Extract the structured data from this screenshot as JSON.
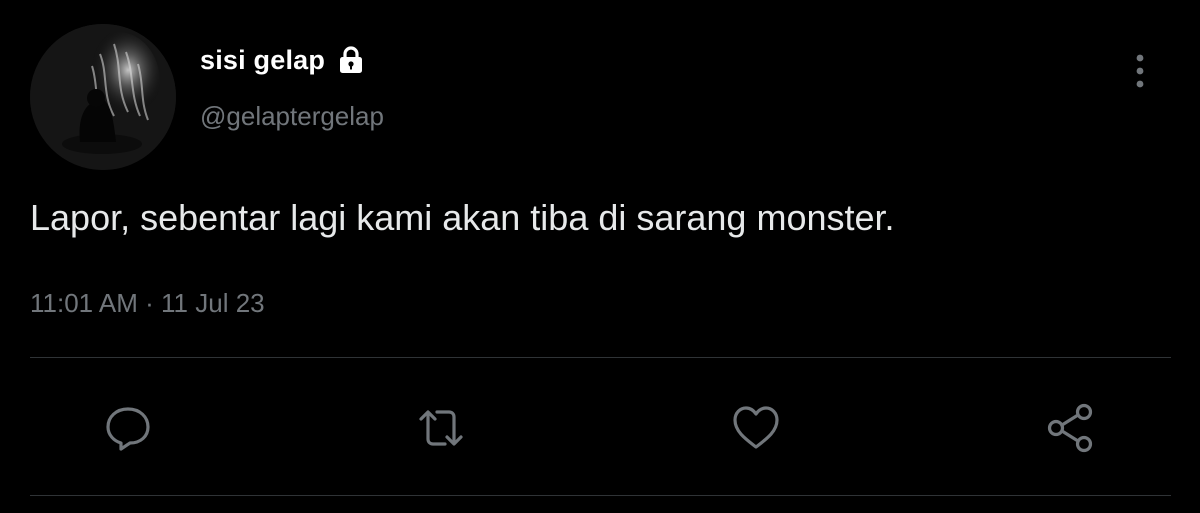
{
  "author": {
    "display_name": "sisi gelap",
    "handle": "@gelaptergelap",
    "protected": true,
    "avatar_icon": "avatar-image"
  },
  "tweet": {
    "text": "Lapor, sebentar lagi kami akan tiba di sarang monster.",
    "timestamp": "11:01 AM · 11 Jul 23"
  },
  "actions": [
    {
      "icon": "reply-icon"
    },
    {
      "icon": "retweet-icon"
    },
    {
      "icon": "like-icon"
    },
    {
      "icon": "share-icon"
    }
  ],
  "colors": {
    "background": "#000000",
    "primary_text": "#e7e9ea",
    "secondary_text": "#71767b",
    "divider": "#2f3336"
  }
}
